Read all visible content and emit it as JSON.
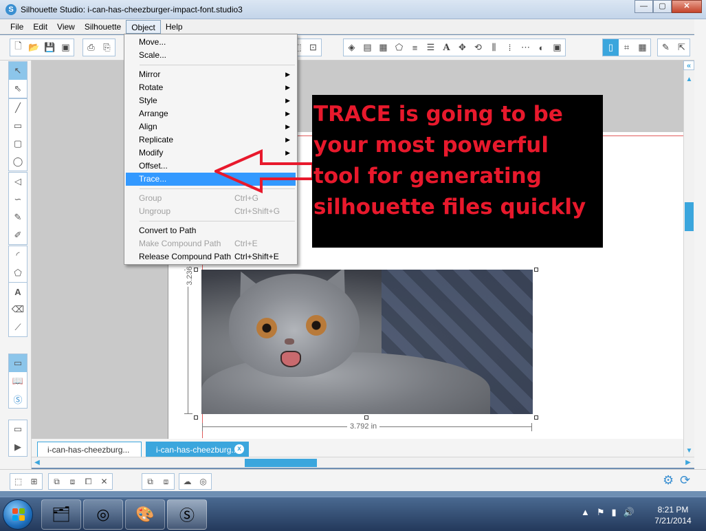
{
  "window": {
    "title": "Silhouette Studio: i-can-has-cheezburger-impact-font.studio3",
    "logo": "S",
    "controls": {
      "minimize": "—",
      "maximize": "▢",
      "close": "✕"
    }
  },
  "menubar": {
    "items": [
      {
        "label": "File"
      },
      {
        "label": "Edit"
      },
      {
        "label": "View"
      },
      {
        "label": "Silhouette"
      },
      {
        "label": "Object",
        "active": true
      },
      {
        "label": "Help"
      }
    ]
  },
  "object_menu": {
    "items": [
      {
        "label": "Move..."
      },
      {
        "label": "Scale..."
      },
      {
        "label": "Mirror",
        "submenu": true
      },
      {
        "label": "Rotate",
        "submenu": true
      },
      {
        "label": "Style",
        "submenu": true
      },
      {
        "label": "Arrange",
        "submenu": true
      },
      {
        "label": "Align",
        "submenu": true
      },
      {
        "label": "Replicate",
        "submenu": true
      },
      {
        "label": "Modify",
        "submenu": true
      },
      {
        "label": "Offset..."
      },
      {
        "label": "Trace...",
        "highlighted": true
      },
      {
        "label": "Group",
        "shortcut": "Ctrl+G",
        "disabled": true
      },
      {
        "label": "Ungroup",
        "shortcut": "Ctrl+Shift+G",
        "disabled": true
      },
      {
        "label": "Convert to Path"
      },
      {
        "label": "Make Compound Path",
        "shortcut": "Ctrl+E",
        "disabled": true
      },
      {
        "label": "Release Compound Path",
        "shortcut": "Ctrl+Shift+E"
      }
    ]
  },
  "canvas": {
    "width_label": "3.792 in",
    "height_label": "3.236"
  },
  "annotation": {
    "text": "TRACE is going to be your most powerful tool for generating silhouette files quickly",
    "text_color": "#e8192c",
    "background": "#000000"
  },
  "tabs": [
    {
      "label": "i-can-has-cheezburg..."
    },
    {
      "label": "i-can-has-cheezburg...",
      "active": true,
      "close": "x"
    }
  ],
  "taskbar": {
    "apps": [
      "file-explorer-icon",
      "chrome-icon",
      "paint-icon",
      "silhouette-studio-icon"
    ],
    "clock": {
      "time": "8:21 PM",
      "date": "7/21/2014"
    }
  },
  "colors": {
    "accent": "#3ba6dd",
    "menu_highlight": "#3399ff"
  }
}
